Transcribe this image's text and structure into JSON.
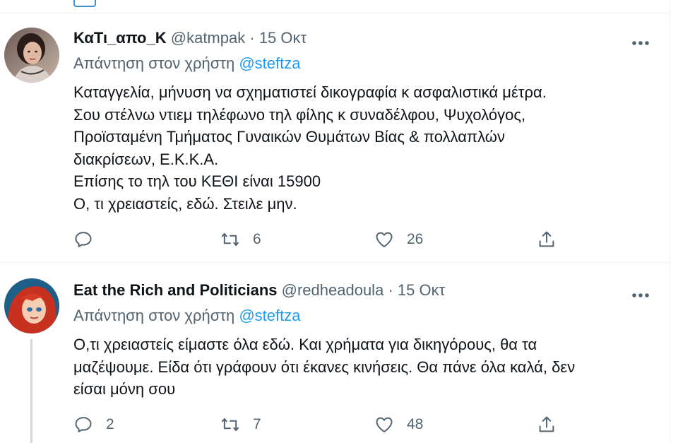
{
  "theme": {
    "text": "#0f1419",
    "secondary": "#536471",
    "link": "#1d9bf0",
    "divider": "#eff3f4"
  },
  "tweets": [
    {
      "display_name": "ΚαΤι_απο_Κ",
      "handle": "@katmpak",
      "separator": "·",
      "date": "15 Οκτ",
      "reply_prefix": "Απάντηση στον χρήστη",
      "reply_mention": "@steftza",
      "lines": [
        "Καταγγελία, μήνυση να σχηματιστεί δικογραφία κ ασφαλιστικά μέτρα.",
        "Σου στέλνω ντιεμ τηλέφωνο τηλ φίλης κ συναδέλφου, Ψυχολόγος,",
        "Προϊσταμένη Τμήματος Γυναικών Θυμάτων Βίας & πολλαπλών",
        "διακρίσεων, Ε.Κ.Κ.Α.",
        "Επίσης το τηλ του ΚΕΘΙ είναι 15900",
        "Ο, τι χρειαστείς, εδώ. Στειλε μην."
      ],
      "reply_count": "",
      "retweet_count": "6",
      "like_count": "26",
      "icons": [
        "more-icon",
        "reply-icon",
        "retweet-icon",
        "like-icon",
        "share-icon"
      ]
    },
    {
      "display_name": "Eat the Rich and Politicians",
      "handle": "@redheadoula",
      "separator": "·",
      "date": "15 Οκτ",
      "reply_prefix": "Απάντηση στον χρήστη",
      "reply_mention": "@steftza",
      "lines": [
        "Ο,τι χρειαστείς είμαστε όλα εδώ. Και χρήματα για δικηγόρους, θα τα",
        "μαζέψουμε. Είδα ότι γράφουν ότι έκανες κινήσεις. Θα πάνε όλα καλά, δεν",
        "είσαι μόνη σου"
      ],
      "reply_count": "2",
      "retweet_count": "7",
      "like_count": "48",
      "icons": [
        "more-icon",
        "reply-icon",
        "retweet-icon",
        "like-icon",
        "share-icon"
      ]
    }
  ]
}
